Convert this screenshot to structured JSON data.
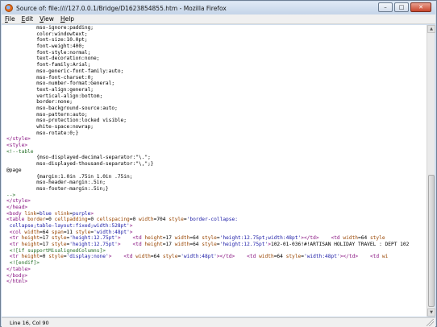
{
  "window": {
    "title": "Source of: file:////127.0.0.1/Bridge/D1623854855.htm - Mozilla Firefox",
    "controls": {
      "minimize": "–",
      "maximize": "□",
      "close": "✕"
    }
  },
  "menu": [
    {
      "label": "File",
      "u": "F",
      "rest": "ile"
    },
    {
      "label": "Edit",
      "u": "E",
      "rest": "dit"
    },
    {
      "label": "View",
      "u": "V",
      "rest": "iew"
    },
    {
      "label": "Help",
      "u": "H",
      "rest": "elp"
    }
  ],
  "source_lines": [
    [
      {
        "t": "          mso-ignore:padding;",
        "c": ""
      }
    ],
    [
      {
        "t": "          color:windowtext;",
        "c": ""
      }
    ],
    [
      {
        "t": "          font-size:10.0pt;",
        "c": ""
      }
    ],
    [
      {
        "t": "          font-weight:400;",
        "c": ""
      }
    ],
    [
      {
        "t": "          font-style:normal;",
        "c": ""
      }
    ],
    [
      {
        "t": "          text-decoration:none;",
        "c": ""
      }
    ],
    [
      {
        "t": "          font-family:Arial;",
        "c": ""
      }
    ],
    [
      {
        "t": "          mso-generic-font-family:auto;",
        "c": ""
      }
    ],
    [
      {
        "t": "          mso-font-charset:0;",
        "c": ""
      }
    ],
    [
      {
        "t": "          mso-number-format:General;",
        "c": ""
      }
    ],
    [
      {
        "t": "          text-align:general;",
        "c": ""
      }
    ],
    [
      {
        "t": "          vertical-align:bottom;",
        "c": ""
      }
    ],
    [
      {
        "t": "          border:none;",
        "c": ""
      }
    ],
    [
      {
        "t": "          mso-background-source:auto;",
        "c": ""
      }
    ],
    [
      {
        "t": "          mso-pattern:auto;",
        "c": ""
      }
    ],
    [
      {
        "t": "          mso-protection:locked visible;",
        "c": ""
      }
    ],
    [
      {
        "t": "          white-space:nowrap;",
        "c": ""
      }
    ],
    [
      {
        "t": "          mso-rotate:0;}",
        "c": ""
      }
    ],
    [
      {
        "t": "</style>",
        "c": "tag"
      }
    ],
    [
      {
        "t": "<style>",
        "c": "tag"
      }
    ],
    [
      {
        "t": "<!--table",
        "c": "cmt"
      }
    ],
    [
      {
        "t": "          {mso-displayed-decimal-separator:\"\\.\";",
        "c": ""
      }
    ],
    [
      {
        "t": "          mso-displayed-thousand-separator:\"\\,\";}",
        "c": ""
      }
    ],
    [
      {
        "t": "@page",
        "c": ""
      }
    ],
    [
      {
        "t": "          {margin:1.0in .75in 1.0in .75in;",
        "c": ""
      }
    ],
    [
      {
        "t": "          mso-header-margin:.5in;",
        "c": ""
      }
    ],
    [
      {
        "t": "          mso-footer-margin:.5in;}",
        "c": ""
      }
    ],
    [
      {
        "t": "-->",
        "c": "cmt"
      }
    ],
    [
      {
        "t": "</style>",
        "c": "tag"
      }
    ],
    [
      {
        "t": "</head>",
        "c": "tag"
      }
    ],
    [
      {
        "t": "<body ",
        "c": "tag"
      },
      {
        "t": "link",
        "c": "attr"
      },
      {
        "t": "=",
        "c": ""
      },
      {
        "t": "blue ",
        "c": "val"
      },
      {
        "t": "vlink",
        "c": "attr"
      },
      {
        "t": "=",
        "c": ""
      },
      {
        "t": "purple",
        "c": "val"
      },
      {
        "t": ">",
        "c": "tag"
      }
    ],
    [
      {
        "t": "<table ",
        "c": "tag"
      },
      {
        "t": "border",
        "c": "attr"
      },
      {
        "t": "=0 ",
        "c": ""
      },
      {
        "t": "cellpadding",
        "c": "attr"
      },
      {
        "t": "=0 ",
        "c": ""
      },
      {
        "t": "cellspacing",
        "c": "attr"
      },
      {
        "t": "=0 ",
        "c": ""
      },
      {
        "t": "width",
        "c": "attr"
      },
      {
        "t": "=704 ",
        "c": ""
      },
      {
        "t": "style",
        "c": "attr"
      },
      {
        "t": "=",
        "c": ""
      },
      {
        "t": "'border-collapse:",
        "c": "val"
      }
    ],
    [
      {
        "t": " collapse;table-layout:fixed;width:528pt'",
        "c": "val"
      },
      {
        "t": ">",
        "c": "tag"
      }
    ],
    [
      {
        "t": " <col ",
        "c": "tag"
      },
      {
        "t": "width",
        "c": "attr"
      },
      {
        "t": "=64 ",
        "c": ""
      },
      {
        "t": "span",
        "c": "attr"
      },
      {
        "t": "=11 ",
        "c": ""
      },
      {
        "t": "style",
        "c": "attr"
      },
      {
        "t": "=",
        "c": ""
      },
      {
        "t": "'width:48pt'",
        "c": "val"
      },
      {
        "t": ">",
        "c": "tag"
      }
    ],
    [
      {
        "t": " <tr ",
        "c": "tag"
      },
      {
        "t": "height",
        "c": "attr"
      },
      {
        "t": "=17 ",
        "c": ""
      },
      {
        "t": "style",
        "c": "attr"
      },
      {
        "t": "=",
        "c": ""
      },
      {
        "t": "'height:12.75pt'",
        "c": "val"
      },
      {
        "t": ">",
        "c": "tag"
      },
      {
        "t": "    ",
        "c": ""
      },
      {
        "t": "<td ",
        "c": "tag"
      },
      {
        "t": "height",
        "c": "attr"
      },
      {
        "t": "=17 ",
        "c": ""
      },
      {
        "t": "width",
        "c": "attr"
      },
      {
        "t": "=64 ",
        "c": ""
      },
      {
        "t": "style",
        "c": "attr"
      },
      {
        "t": "=",
        "c": ""
      },
      {
        "t": "'height:12.75pt;width:48pt'",
        "c": "val"
      },
      {
        "t": "></td>",
        "c": "tag"
      },
      {
        "t": "    ",
        "c": ""
      },
      {
        "t": "<td ",
        "c": "tag"
      },
      {
        "t": "width",
        "c": "attr"
      },
      {
        "t": "=64 ",
        "c": ""
      },
      {
        "t": "style",
        "c": "attr"
      }
    ],
    [
      {
        "t": " <tr ",
        "c": "tag"
      },
      {
        "t": "height",
        "c": "attr"
      },
      {
        "t": "=17 ",
        "c": ""
      },
      {
        "t": "style",
        "c": "attr"
      },
      {
        "t": "=",
        "c": ""
      },
      {
        "t": "'height:12.75pt'",
        "c": "val"
      },
      {
        "t": ">",
        "c": "tag"
      },
      {
        "t": "    ",
        "c": ""
      },
      {
        "t": "<td ",
        "c": "tag"
      },
      {
        "t": "height",
        "c": "attr"
      },
      {
        "t": "=17 ",
        "c": ""
      },
      {
        "t": "width",
        "c": "attr"
      },
      {
        "t": "=64 ",
        "c": ""
      },
      {
        "t": "style",
        "c": "attr"
      },
      {
        "t": "=",
        "c": ""
      },
      {
        "t": "'height:12.75pt'",
        "c": "val"
      },
      {
        "t": ">",
        "c": "tag"
      },
      {
        "t": "102-01-036!#!ARTISAN HOLIDAY TRAVEL : DEPT 102",
        "c": ""
      }
    ],
    [
      {
        "t": " <![if supportMisalignedColumns]>",
        "c": "cmt"
      }
    ],
    [
      {
        "t": " <tr ",
        "c": "tag"
      },
      {
        "t": "height",
        "c": "attr"
      },
      {
        "t": "=0 ",
        "c": ""
      },
      {
        "t": "style",
        "c": "attr"
      },
      {
        "t": "=",
        "c": ""
      },
      {
        "t": "'display:none'",
        "c": "val"
      },
      {
        "t": ">",
        "c": "tag"
      },
      {
        "t": "    ",
        "c": ""
      },
      {
        "t": "<td ",
        "c": "tag"
      },
      {
        "t": "width",
        "c": "attr"
      },
      {
        "t": "=64 ",
        "c": ""
      },
      {
        "t": "style",
        "c": "attr"
      },
      {
        "t": "=",
        "c": ""
      },
      {
        "t": "'width:48pt'",
        "c": "val"
      },
      {
        "t": "></td>",
        "c": "tag"
      },
      {
        "t": "    ",
        "c": ""
      },
      {
        "t": "<td ",
        "c": "tag"
      },
      {
        "t": "width",
        "c": "attr"
      },
      {
        "t": "=64 ",
        "c": ""
      },
      {
        "t": "style",
        "c": "attr"
      },
      {
        "t": "=",
        "c": ""
      },
      {
        "t": "'width:48pt'",
        "c": "val"
      },
      {
        "t": "></td>",
        "c": "tag"
      },
      {
        "t": "    ",
        "c": ""
      },
      {
        "t": "<td ",
        "c": "tag"
      },
      {
        "t": "wi",
        "c": "attr"
      }
    ],
    [
      {
        "t": " <![endif]>",
        "c": "cmt"
      }
    ],
    [
      {
        "t": "</table>",
        "c": "tag"
      }
    ],
    [
      {
        "t": "</body>",
        "c": "tag"
      }
    ],
    [
      {
        "t": "</html>",
        "c": "tag"
      }
    ]
  ],
  "status": {
    "text": "Line 16, Col 90"
  }
}
